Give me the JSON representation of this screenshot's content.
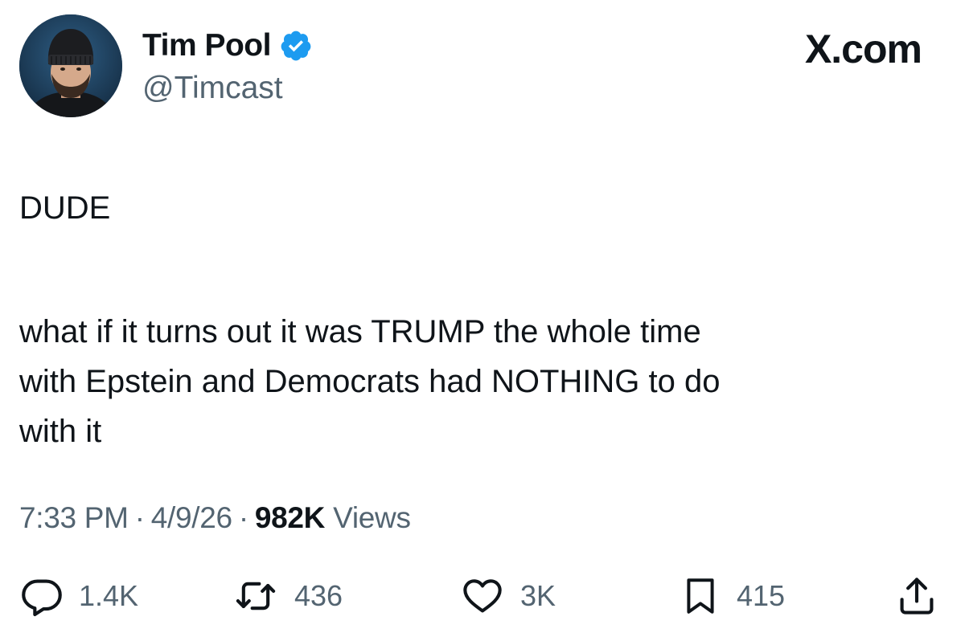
{
  "header": {
    "display_name": "Tim Pool",
    "handle": "@Timcast",
    "brand": "X.com",
    "verified_icon": "verified-badge-icon",
    "verified_color": "#1d9bf0"
  },
  "tweet": {
    "lines": [
      "DUDE",
      "what if it turns out it was TRUMP the whole time",
      "with Epstein and Democrats had NOTHING to do",
      "with it"
    ]
  },
  "meta": {
    "time": "7:33 PM",
    "date": "4/9/26",
    "separator": "·",
    "views_count": "982K",
    "views_label": "Views"
  },
  "actions": {
    "reply": {
      "icon": "reply-icon",
      "count": "1.4K"
    },
    "retweet": {
      "icon": "retweet-icon",
      "count": "436"
    },
    "like": {
      "icon": "heart-icon",
      "count": "3K"
    },
    "bookmark": {
      "icon": "bookmark-icon",
      "count": "415"
    },
    "share": {
      "icon": "share-icon"
    }
  },
  "colors": {
    "text_primary": "#0f1419",
    "text_secondary": "#536471",
    "accent": "#1d9bf0"
  }
}
